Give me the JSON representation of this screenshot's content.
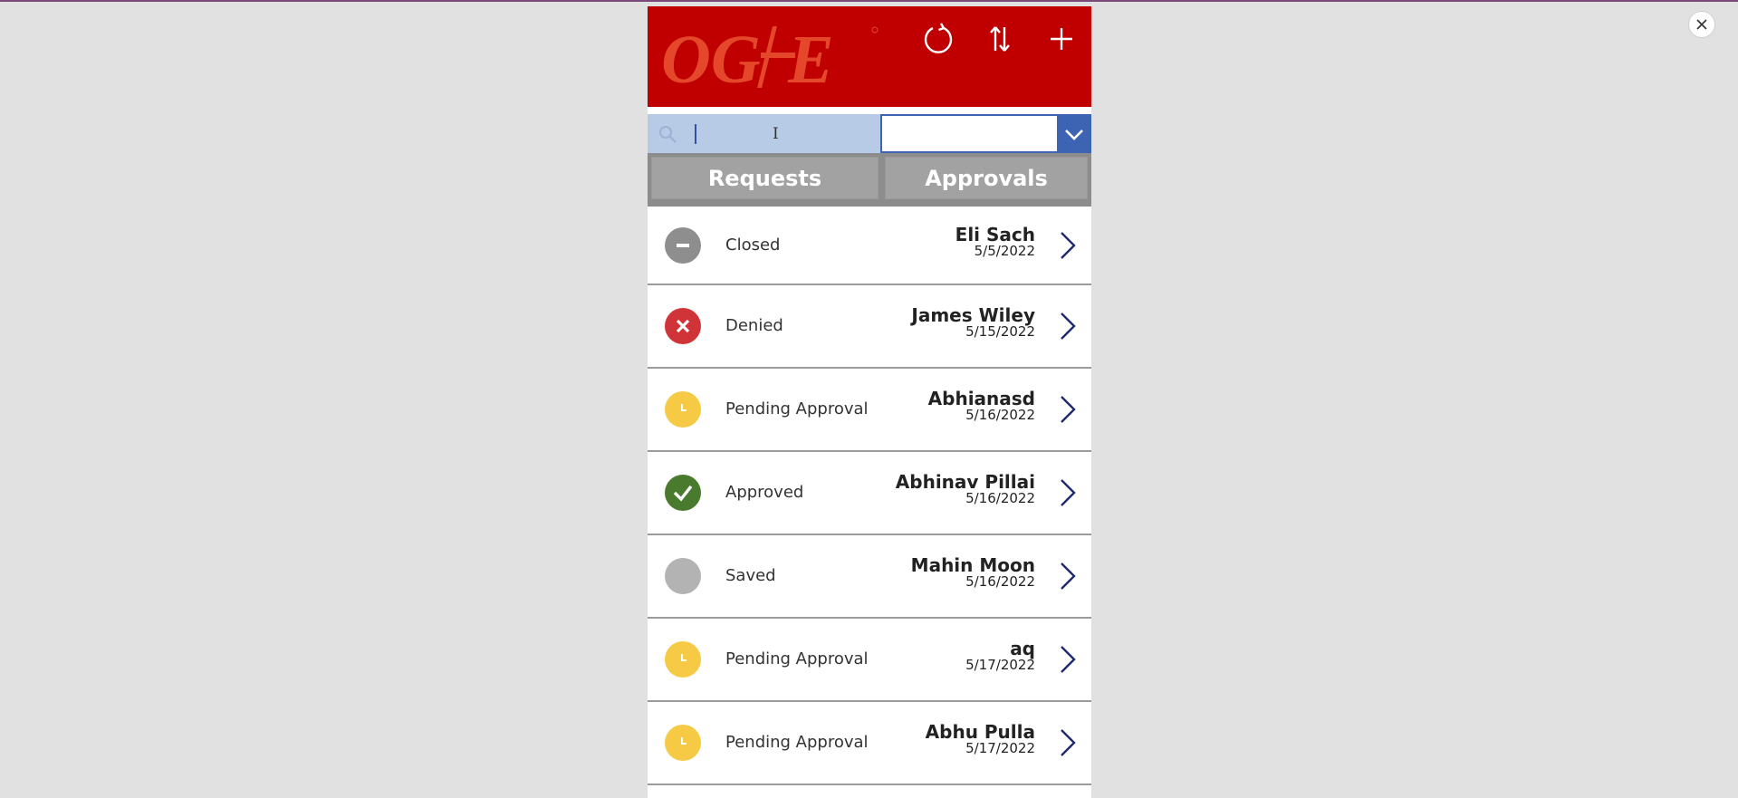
{
  "header": {
    "logo_text": "OG+E",
    "refresh_icon": "refresh-icon",
    "sort_icon": "sort-icon",
    "add_icon": "plus-icon",
    "color": "#c00000"
  },
  "search": {
    "placeholder": "",
    "value": "",
    "filter_value": ""
  },
  "tabs": [
    {
      "label": "Requests"
    },
    {
      "label": "Approvals"
    }
  ],
  "colors": {
    "closed": "#8e8e8e",
    "denied": "#d13438",
    "pending": "#f7ca45",
    "approved": "#4a7a2e",
    "saved": "#b3b3b3",
    "accent": "#3d64b3"
  },
  "requests": [
    {
      "status": "Closed",
      "status_icon": "minus-icon",
      "name": "Eli Sach",
      "date": "5/5/2022"
    },
    {
      "status": "Denied",
      "status_icon": "x-icon",
      "name": "James Wiley",
      "date": "5/15/2022"
    },
    {
      "status": "Pending Approval",
      "status_icon": "clock-icon",
      "name": "Abhianasd",
      "date": "5/16/2022"
    },
    {
      "status": "Approved",
      "status_icon": "check-icon",
      "name": "Abhinav Pillai",
      "date": "5/16/2022"
    },
    {
      "status": "Saved",
      "status_icon": "circle-icon",
      "name": "Mahin Moon",
      "date": "5/16/2022"
    },
    {
      "status": "Pending Approval",
      "status_icon": "clock-icon",
      "name": "aq",
      "date": "5/17/2022"
    },
    {
      "status": "Pending Approval",
      "status_icon": "clock-icon",
      "name": "Abhu Pulla",
      "date": "5/17/2022"
    }
  ]
}
